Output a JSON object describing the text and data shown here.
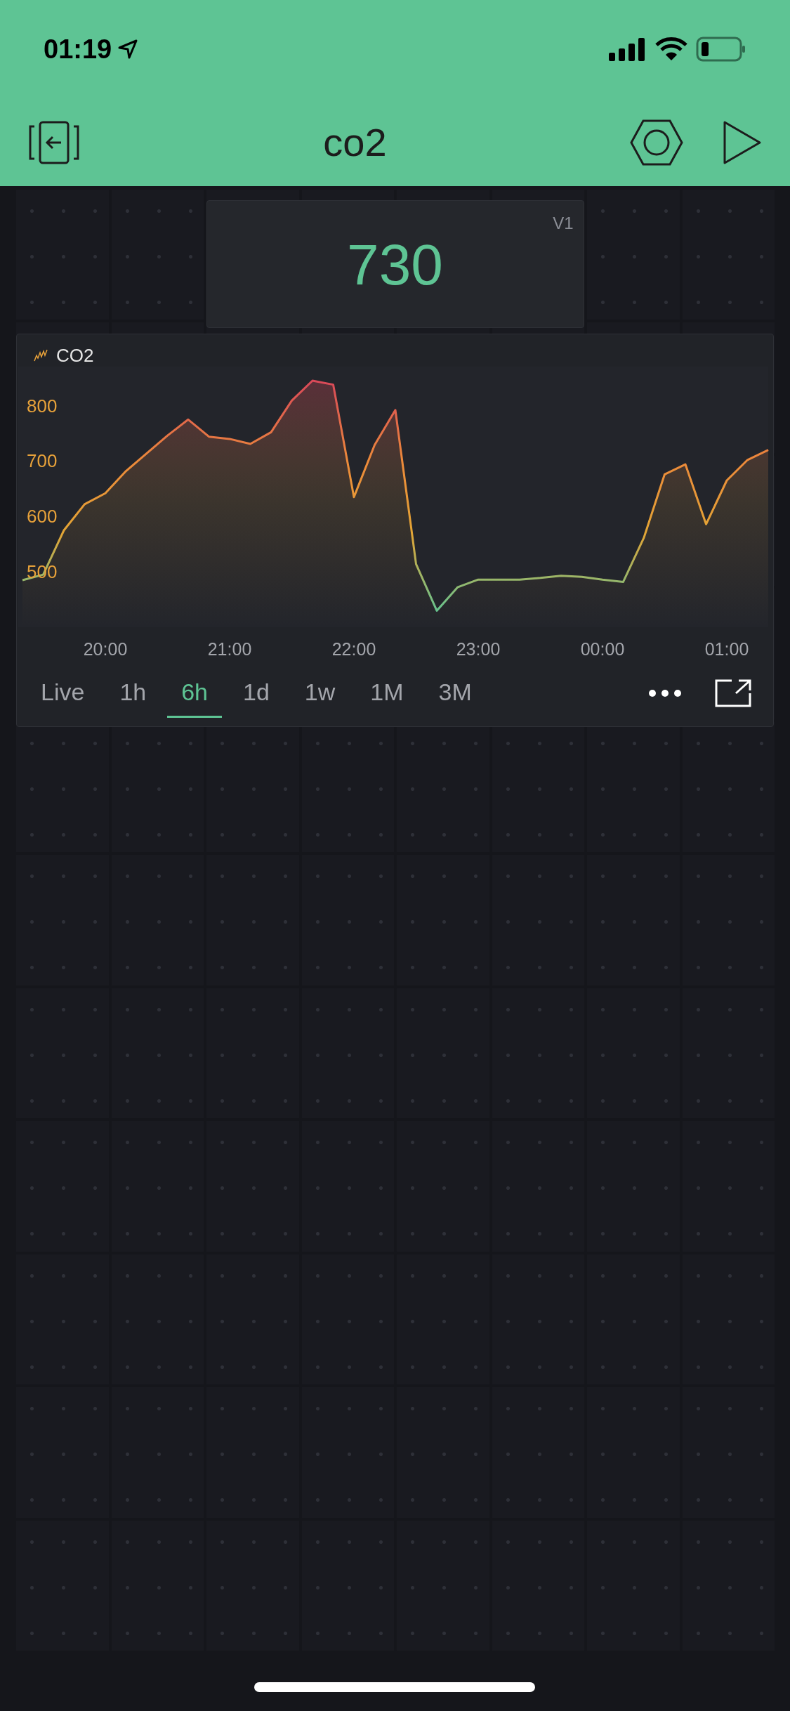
{
  "status_bar": {
    "time": "01:19"
  },
  "header": {
    "title": "co2"
  },
  "value_display": {
    "pin": "V1",
    "value": "730"
  },
  "chart_widget": {
    "chart_data": {
      "type": "area",
      "ylim": [
        220,
        930
      ],
      "yticks": [
        500,
        600,
        700,
        800
      ],
      "categories": [
        null,
        null,
        null,
        null,
        "20:00",
        null,
        null,
        null,
        null,
        null,
        "21:00",
        null,
        null,
        null,
        null,
        null,
        "22:00",
        null,
        null,
        null,
        null,
        null,
        "23:00",
        null,
        null,
        null,
        null,
        null,
        "00:00",
        null,
        null,
        null,
        null,
        null,
        "01:00",
        null,
        null
      ],
      "series": [
        {
          "name": "CO2",
          "values": [
            485,
            495,
            575,
            622,
            642,
            682,
            714,
            746,
            775,
            744,
            740,
            731,
            752,
            809,
            845,
            838,
            635,
            729,
            792,
            514,
            430,
            472,
            486,
            486,
            486,
            489,
            493,
            491,
            486,
            482,
            562,
            676,
            694,
            586,
            665,
            702,
            720
          ]
        }
      ]
    },
    "periods": [
      {
        "label": "Live",
        "selected": false
      },
      {
        "label": "1h",
        "selected": false
      },
      {
        "label": "6h",
        "selected": true
      },
      {
        "label": "1d",
        "selected": false
      },
      {
        "label": "1w",
        "selected": false
      },
      {
        "label": "1M",
        "selected": false
      },
      {
        "label": "3M",
        "selected": false
      }
    ]
  }
}
